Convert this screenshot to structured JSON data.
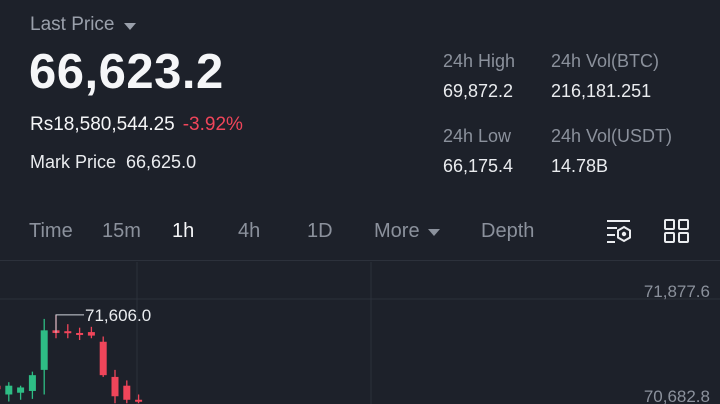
{
  "header": {
    "last_price_label": "Last Price",
    "last_price": "66,623.2",
    "fiat_price": "Rs18,580,544.25",
    "change_pct": "-3.92%",
    "mark_price_label": "Mark Price",
    "mark_price": "66,625.0"
  },
  "stats": {
    "high_label": "24h High",
    "high_value": "69,872.2",
    "vol_btc_label": "24h Vol(BTC)",
    "vol_btc_value": "216,181.251",
    "low_label": "24h Low",
    "low_value": "66,175.4",
    "vol_usdt_label": "24h Vol(USDT)",
    "vol_usdt_value": "14.78B"
  },
  "tabs": {
    "time": "Time",
    "m15": "15m",
    "h1": "1h",
    "h4": "4h",
    "d1": "1D",
    "more": "More",
    "depth": "Depth",
    "active": "1h"
  },
  "icons": {
    "indicator": "indicator-settings-icon",
    "layout": "grid-layout-icon"
  },
  "colors": {
    "up": "#2ebd85",
    "down": "#f0455a",
    "background": "#1d212a"
  },
  "chart_data": {
    "type": "candlestick",
    "y_ticks": [
      "71,877.6",
      "70,682.8"
    ],
    "y_tick_values": [
      71877.6,
      70682.8
    ],
    "high_marker": "71,606.0",
    "high_marker_value": 71606.0,
    "ylim": [
      70600,
      72080
    ],
    "candles": [
      {
        "open": 70800,
        "high": 70870,
        "low": 70620,
        "close": 70760
      },
      {
        "open": 70700,
        "high": 70840,
        "low": 70620,
        "close": 70800
      },
      {
        "open": 70720,
        "high": 70800,
        "low": 70640,
        "close": 70780
      },
      {
        "open": 70740,
        "high": 70960,
        "low": 70650,
        "close": 70920
      },
      {
        "open": 70980,
        "high": 71560,
        "low": 70700,
        "close": 71430
      },
      {
        "open": 71430,
        "high": 71606,
        "low": 71340,
        "close": 71400
      },
      {
        "open": 71420,
        "high": 71500,
        "low": 71340,
        "close": 71410
      },
      {
        "open": 71400,
        "high": 71460,
        "low": 71320,
        "close": 71390
      },
      {
        "open": 71410,
        "high": 71470,
        "low": 71340,
        "close": 71370
      },
      {
        "open": 71300,
        "high": 71360,
        "low": 70900,
        "close": 70920
      },
      {
        "open": 70900,
        "high": 70980,
        "low": 70600,
        "close": 70680
      },
      {
        "open": 70800,
        "high": 70860,
        "low": 70600,
        "close": 70640
      },
      {
        "open": 70640,
        "high": 70700,
        "low": 70600,
        "close": 70620
      }
    ]
  }
}
